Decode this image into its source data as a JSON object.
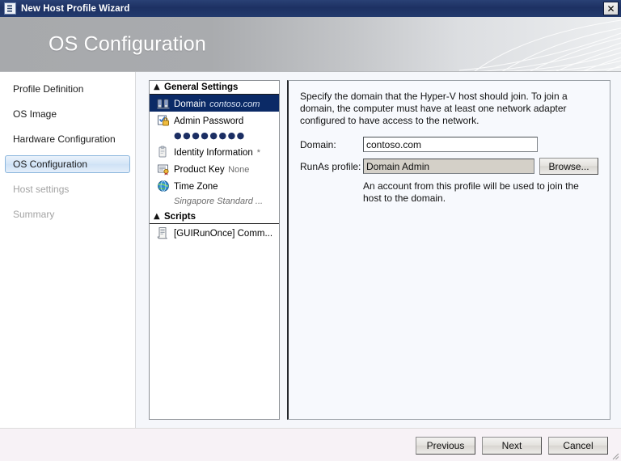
{
  "window": {
    "title": "New Host Profile Wizard",
    "title_icon": "document-icon",
    "close_label": "✕"
  },
  "banner": {
    "heading": "OS Configuration"
  },
  "sidebar": {
    "items": [
      {
        "label": "Profile Definition",
        "state": "normal"
      },
      {
        "label": "OS Image",
        "state": "normal"
      },
      {
        "label": "Hardware Configuration",
        "state": "normal"
      },
      {
        "label": "OS Configuration",
        "state": "selected"
      },
      {
        "label": "Host settings",
        "state": "disabled"
      },
      {
        "label": "Summary",
        "state": "disabled"
      }
    ]
  },
  "tree": {
    "sections": [
      {
        "label": "General Settings",
        "collapse_icon": "chevron-up-icon",
        "items": [
          {
            "label": "Domain",
            "sub": "contoso.com",
            "sub_style": "italic",
            "icon": "domain-servers-icon",
            "selected": true
          },
          {
            "label": "Admin Password",
            "sub": "●●●●●●●●",
            "sub_style": "dots",
            "icon": "password-lock-icon",
            "selected": false
          },
          {
            "label": "Identity Information",
            "sub": "*",
            "sub_style": "italic",
            "icon": "identity-tag-icon",
            "selected": false
          },
          {
            "label": "Product Key",
            "sub": "None",
            "sub_style": "plain",
            "icon": "product-key-certificate-icon",
            "selected": false
          },
          {
            "label": "Time Zone",
            "sub": "Singapore Standard ...",
            "sub_style": "italic",
            "icon": "globe-clock-icon",
            "selected": false
          }
        ]
      },
      {
        "label": "Scripts",
        "collapse_icon": "chevron-up-icon",
        "items": [
          {
            "label": "[GUIRunOnce] Comm...",
            "sub": "",
            "sub_style": "plain",
            "icon": "script-document-icon",
            "selected": false
          }
        ]
      }
    ]
  },
  "content": {
    "description": "Specify the domain that the Hyper-V host should join. To join a domain, the computer must have at least one network adapter configured to have access to the network.",
    "domain_label": "Domain:",
    "domain_value": "contoso.com",
    "domain_placeholder": "",
    "runas_label": "RunAs profile:",
    "runas_value": "Domain Admin",
    "browse_label": "Browse...",
    "runas_hint": "An account from this profile will be used to join the host to the domain."
  },
  "footer": {
    "previous_label": "Previous",
    "next_label": "Next",
    "cancel_label": "Cancel"
  },
  "colors": {
    "titlebar": "#1d3163",
    "selection": "#0b2a66",
    "nav_selected_border": "#8bb6dd",
    "content_bg": "#f7f9fd"
  }
}
